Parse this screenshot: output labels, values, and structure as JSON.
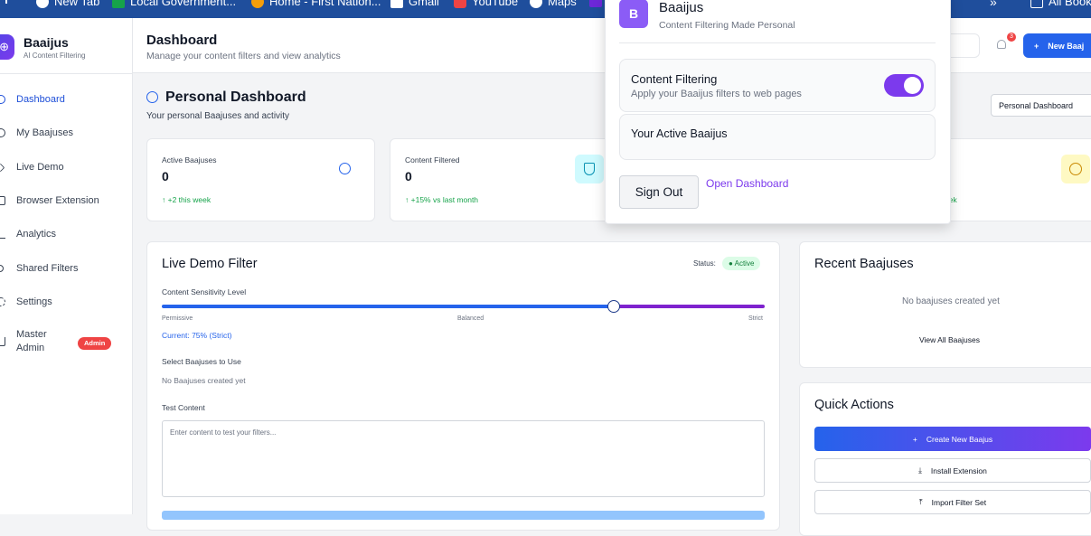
{
  "bookmarks": {
    "items": [
      {
        "label": "New Tab"
      },
      {
        "label": "Local Government..."
      },
      {
        "label": "Home - First Nation..."
      },
      {
        "label": "Gmail"
      },
      {
        "label": "YouTube"
      },
      {
        "label": "Maps"
      }
    ],
    "more_label": "»",
    "all_bookmarks_label": "All Book"
  },
  "brand": {
    "logo_letter": "B",
    "name": "Baaijus",
    "subtitle": "AI Content Filtering"
  },
  "sidebar": {
    "items": [
      {
        "label": "Dashboard",
        "icon": "brain-icon"
      },
      {
        "label": "My Baajuses",
        "icon": "brain-icon"
      },
      {
        "label": "Live Demo",
        "icon": "chevron-right-icon"
      },
      {
        "label": "Browser Extension",
        "icon": "puzzle-icon"
      },
      {
        "label": "Analytics",
        "icon": "bar-chart-icon"
      },
      {
        "label": "Shared Filters",
        "icon": "share-icon"
      },
      {
        "label": "Settings",
        "icon": "gear-icon"
      },
      {
        "label": "Master Admin",
        "icon": "crown-icon"
      }
    ],
    "admin_badge": "Admin"
  },
  "header": {
    "title": "Dashboard",
    "subtitle": "Manage your content filters and view analytics",
    "notification_count": "3",
    "new_button_label": "New Baaj"
  },
  "dashboard": {
    "title": "Personal Dashboard",
    "subtitle": "Your personal Baajuses and activity",
    "view_select": "Personal Dashboard"
  },
  "stats": [
    {
      "label": "Active Baajuses",
      "value": "0",
      "trend": "+2 this week",
      "icon": "brain-icon"
    },
    {
      "label": "Content Filtered",
      "value": "0",
      "trend": "+15% vs last month",
      "icon": "shield-icon"
    },
    {
      "trend_fragment": "eek",
      "icon": "clock-icon"
    }
  ],
  "live_demo": {
    "title": "Live Demo Filter",
    "status_label": "Status:",
    "status_value": "Active",
    "sensitivity_label": "Content Sensitivity Level",
    "sensitivity_value": 75,
    "scale_labels": [
      "Permissive",
      "Balanced",
      "Strict"
    ],
    "current_text": "Current: 75% (Strict)",
    "select_label": "Select Baajuses to Use",
    "no_baajuses": "No Baajuses created yet",
    "test_label": "Test Content",
    "test_placeholder": "Enter content to test your filters..."
  },
  "recent": {
    "title": "Recent Baajuses",
    "empty_text": "No baajuses created yet",
    "view_all": "View All Baajuses"
  },
  "quick_actions": {
    "title": "Quick Actions",
    "create": "Create New Baajus",
    "install": "Install Extension",
    "import": "Import Filter Set"
  },
  "popup": {
    "logo_letter": "B",
    "title": "Baaijus",
    "subtitle": "Content Filtering Made Personal",
    "filtering_title": "Content Filtering",
    "filtering_desc": "Apply your Baaijus filters to web pages",
    "filtering_enabled": true,
    "active_title": "Your Active Baaijus",
    "sign_out": "Sign Out",
    "open_dashboard": "Open Dashboard"
  },
  "colors": {
    "primary": "#2563eb",
    "accent": "#7c3aed",
    "success": "#16a34a",
    "danger": "#ef4444"
  }
}
